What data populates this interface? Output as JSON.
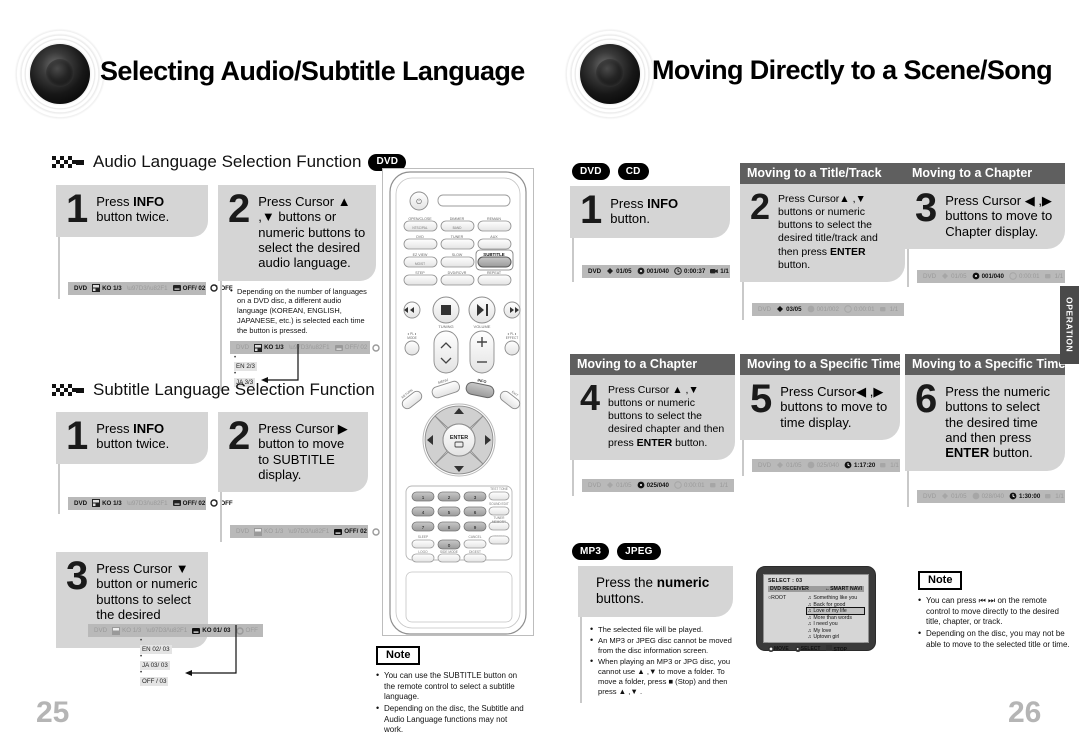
{
  "left_page": {
    "title": "Selecting Audio/Subtitle Language",
    "folio": "25",
    "sections": [
      {
        "heading": "Audio Language Selection Function",
        "disc": "DVD",
        "steps": [
          {
            "num": "1",
            "text_html": "Press <b>INFO</b> button twice.",
            "osd": {
              "label": "DVD",
              "items": [
                "KO 1/3",
                "韓/英",
                "OFF/ 02",
                "OFF"
              ]
            }
          },
          {
            "num": "2",
            "text_html": "Press Cursor ▲ ,▼ buttons or numeric buttons to select the desired audio language.",
            "note": "Depending on the number of languages on a DVD disc, a different audio language (KOREAN, ENGLISH, JAPANESE, etc.) is selected each time the button is pressed.",
            "osd": {
              "label": "DVD",
              "items": [
                "KO 1/3",
                "韓/英",
                "OFF/ 02",
                "OFF"
              ]
            },
            "options": [
              "EN 2/3",
              "JA 3/3"
            ]
          }
        ]
      },
      {
        "heading": "Subtitle Language Selection Function",
        "disc": "DVD",
        "steps": [
          {
            "num": "1",
            "text_html": "Press <b>INFO</b> button twice.",
            "osd": {
              "label": "DVD",
              "items": [
                "KO 1/3",
                "韓/英",
                "OFF/ 02",
                "OFF"
              ]
            }
          },
          {
            "num": "2",
            "text_html": "Press Cursor ▶ button to move to SUBTITLE display.",
            "osd": {
              "label": "DVD",
              "items": [
                "KO 1/3",
                "韓/英",
                "OFF/ 02",
                "OFF"
              ]
            }
          },
          {
            "num": "3",
            "text_html": "Press Cursor ▼ button or numeric buttons to select the desired subtitle.",
            "osd": {
              "label": "DVD",
              "items": [
                "KO 1/3",
                "韓/英",
                "KO 01/ 03",
                "OFF"
              ]
            },
            "options": [
              "EN 02/ 03",
              "JA 03/ 03",
              "OFF / 03"
            ]
          }
        ]
      }
    ],
    "note": {
      "label": "Note",
      "items": [
        "You can use the SUBTITLE button on the remote control to select a subtitle language.",
        "Depending on the disc, the Subtitle and Audio Language functions may not work."
      ]
    },
    "remote": {
      "power_label": "",
      "rows": [
        [
          "OPEN/CLOSE",
          "DIMMER",
          "REMAIN"
        ],
        [
          "DVD",
          "TUNER/BAND",
          "AUX"
        ],
        [
          "EZ VIEW/NTSC/PAL",
          "SLOW/MO/ST",
          "SUBTITLE"
        ],
        [
          "STEP",
          "DVD/RCVR",
          "REPEAT"
        ]
      ],
      "transport": [
        "❘◀◀",
        "■",
        "▶❙❙",
        "▶▶❘"
      ],
      "tuning_label": "TUNING",
      "volume_label": "VOLUME",
      "side_left": "Ⅱ PL Ⅱ MODE",
      "side_right": "Ⅱ PL Ⅱ EFFECT",
      "menu_label": "MENU",
      "info_label": "INFO",
      "return_label": "RETURN",
      "exit_label": "EXIT",
      "enter_label": "ENTER",
      "numbers": [
        "1",
        "2",
        "3",
        "4",
        "5",
        "6",
        "7",
        "8",
        "9",
        "0"
      ],
      "right_col": [
        "TEST TONE",
        "SOUND EDIT",
        "TUNER MEMORY",
        "ZOOM"
      ],
      "bottom_row": [
        "SLEEP",
        "CANCEL",
        "LOGO",
        "SIDE MODE",
        "DIGEST"
      ]
    }
  },
  "right_page": {
    "title": "Moving Directly to a Scene/Song",
    "folio": "26",
    "discs_top": [
      "DVD",
      "CD"
    ],
    "operation_tab": "OPERATION",
    "steps": [
      {
        "num": "1",
        "header": "",
        "text_html": "Press <b>INFO</b> button.",
        "osd": {
          "label": "DVD",
          "items": [
            "01/05",
            "001/040",
            "0:00:37",
            "1/1"
          ],
          "active": [
            0,
            1,
            2,
            3
          ]
        }
      },
      {
        "num": "2",
        "header": "Moving to a Title/Track",
        "text_html": "Press Cursor ▲ ,▼ buttons or numeric buttons to select the desired title/track and then press <b>ENTER</b> button.",
        "osd": {
          "label": "DVD",
          "items": [
            "03/05",
            "001/002",
            "0:00:01",
            "1/1"
          ],
          "active": [
            0
          ]
        }
      },
      {
        "num": "3",
        "header": "Moving to a Chapter",
        "text_html": "Press Cursor ◀ ,▶ buttons to move to Chapter display.",
        "osd": {
          "label": "DVD",
          "items": [
            "01/05",
            "001/040",
            "0:00:01",
            "1/1"
          ],
          "active": [
            1
          ]
        }
      },
      {
        "num": "4",
        "header": "Moving to a Chapter",
        "text_html": "Press Cursor ▲ ,▼ buttons or numeric buttons to select the desired chapter and then press <b>ENTER</b> button.",
        "osd": {
          "label": "DVD",
          "items": [
            "01/05",
            "025/040",
            "0:00:01",
            "1/1"
          ],
          "active": [
            1
          ]
        }
      },
      {
        "num": "5",
        "header": "Moving to a Specific Time",
        "text_html": "Press Cursor◀ ,▶ buttons to move to time display.",
        "osd": {
          "label": "DVD",
          "items": [
            "01/05",
            "025/040",
            "1:17:20",
            "1/1"
          ],
          "active": [
            2
          ]
        }
      },
      {
        "num": "6",
        "header": "Moving to a Specific Time",
        "text_html": "Press the numeric buttons to select the desired time and then press <b>ENTER</b> button.",
        "osd": {
          "label": "DVD",
          "items": [
            "01/05",
            "028/040",
            "1:30:00",
            "1/1"
          ],
          "active": [
            2
          ]
        }
      }
    ],
    "mp3_section": {
      "discs": [
        "MP3",
        "JPEG"
      ],
      "instruction_html": "Press the <b>numeric</b> buttons.",
      "notes": [
        "The selected file will be played.",
        "An MP3 or JPEG disc cannot be moved from the disc information screen.",
        "When playing an MP3 or JPG disc, you cannot use ▲ ,▼  to move a folder. To move a folder, press ■ (Stop) and then press ▲ ,▼ ."
      ]
    },
    "tv_screen": {
      "select_label": "SELECT :",
      "select_value": "03",
      "device": "DVD RECEIVER",
      "nav_label": "SMART NAVI",
      "root": "ROOT",
      "files": [
        "Something like you",
        "Back for good",
        "Love of my life",
        "More than words",
        "I need you",
        "My love",
        "Uptown girl"
      ],
      "selected_index": 2,
      "footer": [
        "MOVE",
        "SELECT",
        "STOP"
      ]
    },
    "note": {
      "label": "Note",
      "items": [
        "You can press ⏮ ⏭  on the remote control to move directly to the desired title, chapter, or track.",
        "Depending on the disc, you may not be able to move to the selected title or time."
      ]
    }
  },
  "colors": {
    "bubble_gray": "#d5d5d5",
    "osd_gray": "#b9b9b9",
    "header_gray": "#5f5f5f",
    "folio_gray": "#b5b5b5",
    "pill_black": "#000000"
  }
}
